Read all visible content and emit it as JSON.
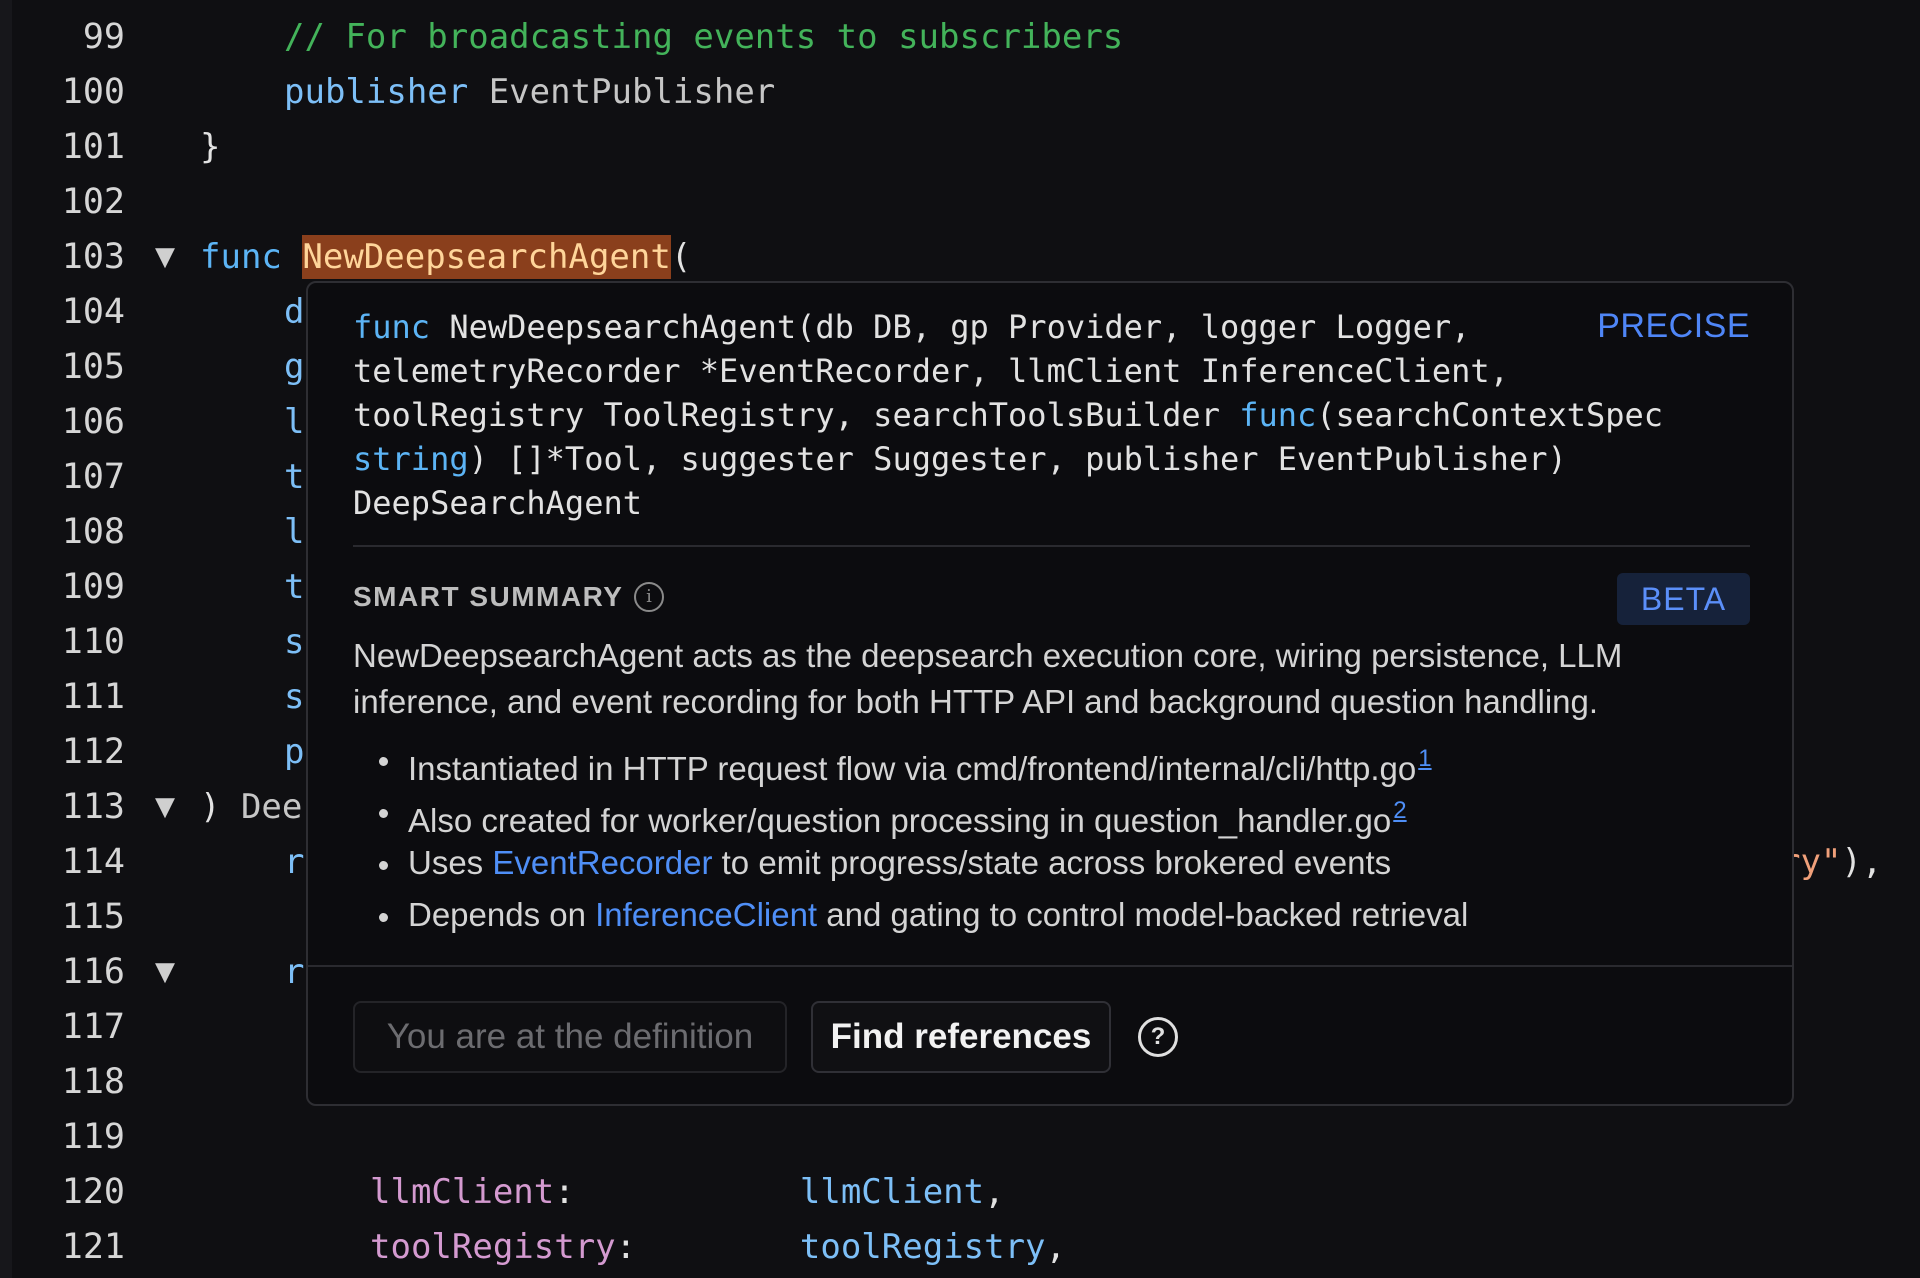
{
  "editor": {
    "lines": [
      {
        "num": "99",
        "fold": "",
        "code": [
          {
            "t": "// For broadcasting events to subscribers",
            "c": "t-comment"
          }
        ],
        "indent": 2
      },
      {
        "num": "100",
        "fold": "",
        "code": [
          {
            "t": "publisher",
            "c": "t-ident"
          },
          {
            "t": " EventPublisher",
            "c": "t-type"
          }
        ],
        "indent": 2
      },
      {
        "num": "101",
        "fold": "",
        "code": [
          {
            "t": "}",
            "c": "t-plain"
          }
        ],
        "indent": 1
      },
      {
        "num": "102",
        "fold": "",
        "code": [],
        "indent": 1
      },
      {
        "num": "103",
        "fold": "▼",
        "code": [
          {
            "t": "func",
            "c": "t-kw"
          },
          {
            "t": " ",
            "c": "t-plain"
          },
          {
            "t": "NewDeepsearchAgent",
            "c": "highlight"
          },
          {
            "t": "(",
            "c": "t-plain"
          }
        ],
        "indent": 1
      },
      {
        "num": "104",
        "fold": "",
        "code": [
          {
            "t": "d",
            "c": "t-ident"
          }
        ],
        "indent": 2
      },
      {
        "num": "105",
        "fold": "",
        "code": [
          {
            "t": "g",
            "c": "t-ident"
          }
        ],
        "indent": 2
      },
      {
        "num": "106",
        "fold": "",
        "code": [
          {
            "t": "l",
            "c": "t-ident"
          }
        ],
        "indent": 2
      },
      {
        "num": "107",
        "fold": "",
        "code": [
          {
            "t": "t",
            "c": "t-ident"
          }
        ],
        "indent": 2
      },
      {
        "num": "108",
        "fold": "",
        "code": [
          {
            "t": "l",
            "c": "t-ident"
          }
        ],
        "indent": 2
      },
      {
        "num": "109",
        "fold": "",
        "code": [
          {
            "t": "t",
            "c": "t-ident"
          }
        ],
        "indent": 2
      },
      {
        "num": "110",
        "fold": "",
        "code": [
          {
            "t": "s",
            "c": "t-ident"
          }
        ],
        "indent": 2
      },
      {
        "num": "111",
        "fold": "",
        "code": [
          {
            "t": "s",
            "c": "t-ident"
          }
        ],
        "indent": 2
      },
      {
        "num": "112",
        "fold": "",
        "code": [
          {
            "t": "p",
            "c": "t-ident"
          }
        ],
        "indent": 2
      },
      {
        "num": "113",
        "fold": "▼",
        "code": [
          {
            "t": ") ",
            "c": "t-plain"
          },
          {
            "t": "Dee",
            "c": "t-type"
          }
        ],
        "indent": 1
      },
      {
        "num": "114",
        "fold": "",
        "code": [
          {
            "t": "r",
            "c": "t-ident"
          }
        ],
        "indent": 2,
        "tail": [
          {
            "t": "ry\"",
            "c": "t-str"
          },
          {
            "t": "),",
            "c": "t-plain"
          }
        ]
      },
      {
        "num": "115",
        "fold": "",
        "code": [],
        "indent": 2
      },
      {
        "num": "116",
        "fold": "▼",
        "code": [
          {
            "t": "r",
            "c": "t-ident"
          }
        ],
        "indent": 2
      },
      {
        "num": "117",
        "fold": "",
        "code": [],
        "indent": 2
      },
      {
        "num": "118",
        "fold": "",
        "code": [],
        "indent": 2
      },
      {
        "num": "119",
        "fold": "",
        "code": [],
        "indent": 2
      },
      {
        "num": "120",
        "fold": "",
        "code": [
          {
            "t": "llmClient",
            "c": "t-field"
          },
          {
            "t": ":           ",
            "c": "t-plain"
          },
          {
            "t": "llmClient",
            "c": "t-ident"
          },
          {
            "t": ",",
            "c": "t-plain"
          }
        ],
        "indent": 3
      },
      {
        "num": "121",
        "fold": "",
        "code": [
          {
            "t": "toolRegistry",
            "c": "t-field"
          },
          {
            "t": ":        ",
            "c": "t-plain"
          },
          {
            "t": "toolRegistry",
            "c": "t-ident"
          },
          {
            "t": ",",
            "c": "t-plain"
          }
        ],
        "indent": 3
      }
    ]
  },
  "hover": {
    "signature": [
      [
        {
          "t": "func",
          "c": "t-kw"
        },
        {
          "t": " NewDeepsearchAgent(db DB, gp Provider, logger Logger,",
          "c": "t-plain"
        }
      ],
      [
        {
          "t": "telemetryRecorder *EventRecorder, llmClient InferenceClient,",
          "c": "t-plain"
        }
      ],
      [
        {
          "t": "toolRegistry ToolRegistry, searchToolsBuilder ",
          "c": "t-plain"
        },
        {
          "t": "func",
          "c": "t-kw"
        },
        {
          "t": "(searchContextSpec",
          "c": "t-plain"
        }
      ],
      [
        {
          "t": "string",
          "c": "t-kw"
        },
        {
          "t": ") []*Tool, suggester Suggester, publisher EventPublisher)",
          "c": "t-plain"
        }
      ],
      [
        {
          "t": "DeepSearchAgent",
          "c": "t-plain"
        }
      ]
    ],
    "precise_label": "PRECISE",
    "smart_summary_title": "SMART SUMMARY",
    "info_icon": "i",
    "beta_label": "BETA",
    "summary_text": "NewDeepsearchAgent acts as the deepsearch execution core, wiring persistence, LLM inference, and event recording for both HTTP API and background question handling.",
    "bullets": [
      {
        "before": "Instantiated in HTTP request flow via cmd/frontend/internal/cli/http.go",
        "link": "",
        "after": "",
        "footnote": "1"
      },
      {
        "before": "Also created for worker/question processing in question_handler.go",
        "link": "",
        "after": "",
        "footnote": "2"
      },
      {
        "before": "Uses ",
        "link": "EventRecorder",
        "after": " to emit progress/state across brokered events",
        "footnote": ""
      },
      {
        "before": "Depends on ",
        "link": "InferenceClient",
        "after": " and gating to control model-backed retrieval",
        "footnote": ""
      }
    ],
    "definition_button": "You are at the definition",
    "find_references_button": "Find references",
    "help_icon": "?"
  }
}
